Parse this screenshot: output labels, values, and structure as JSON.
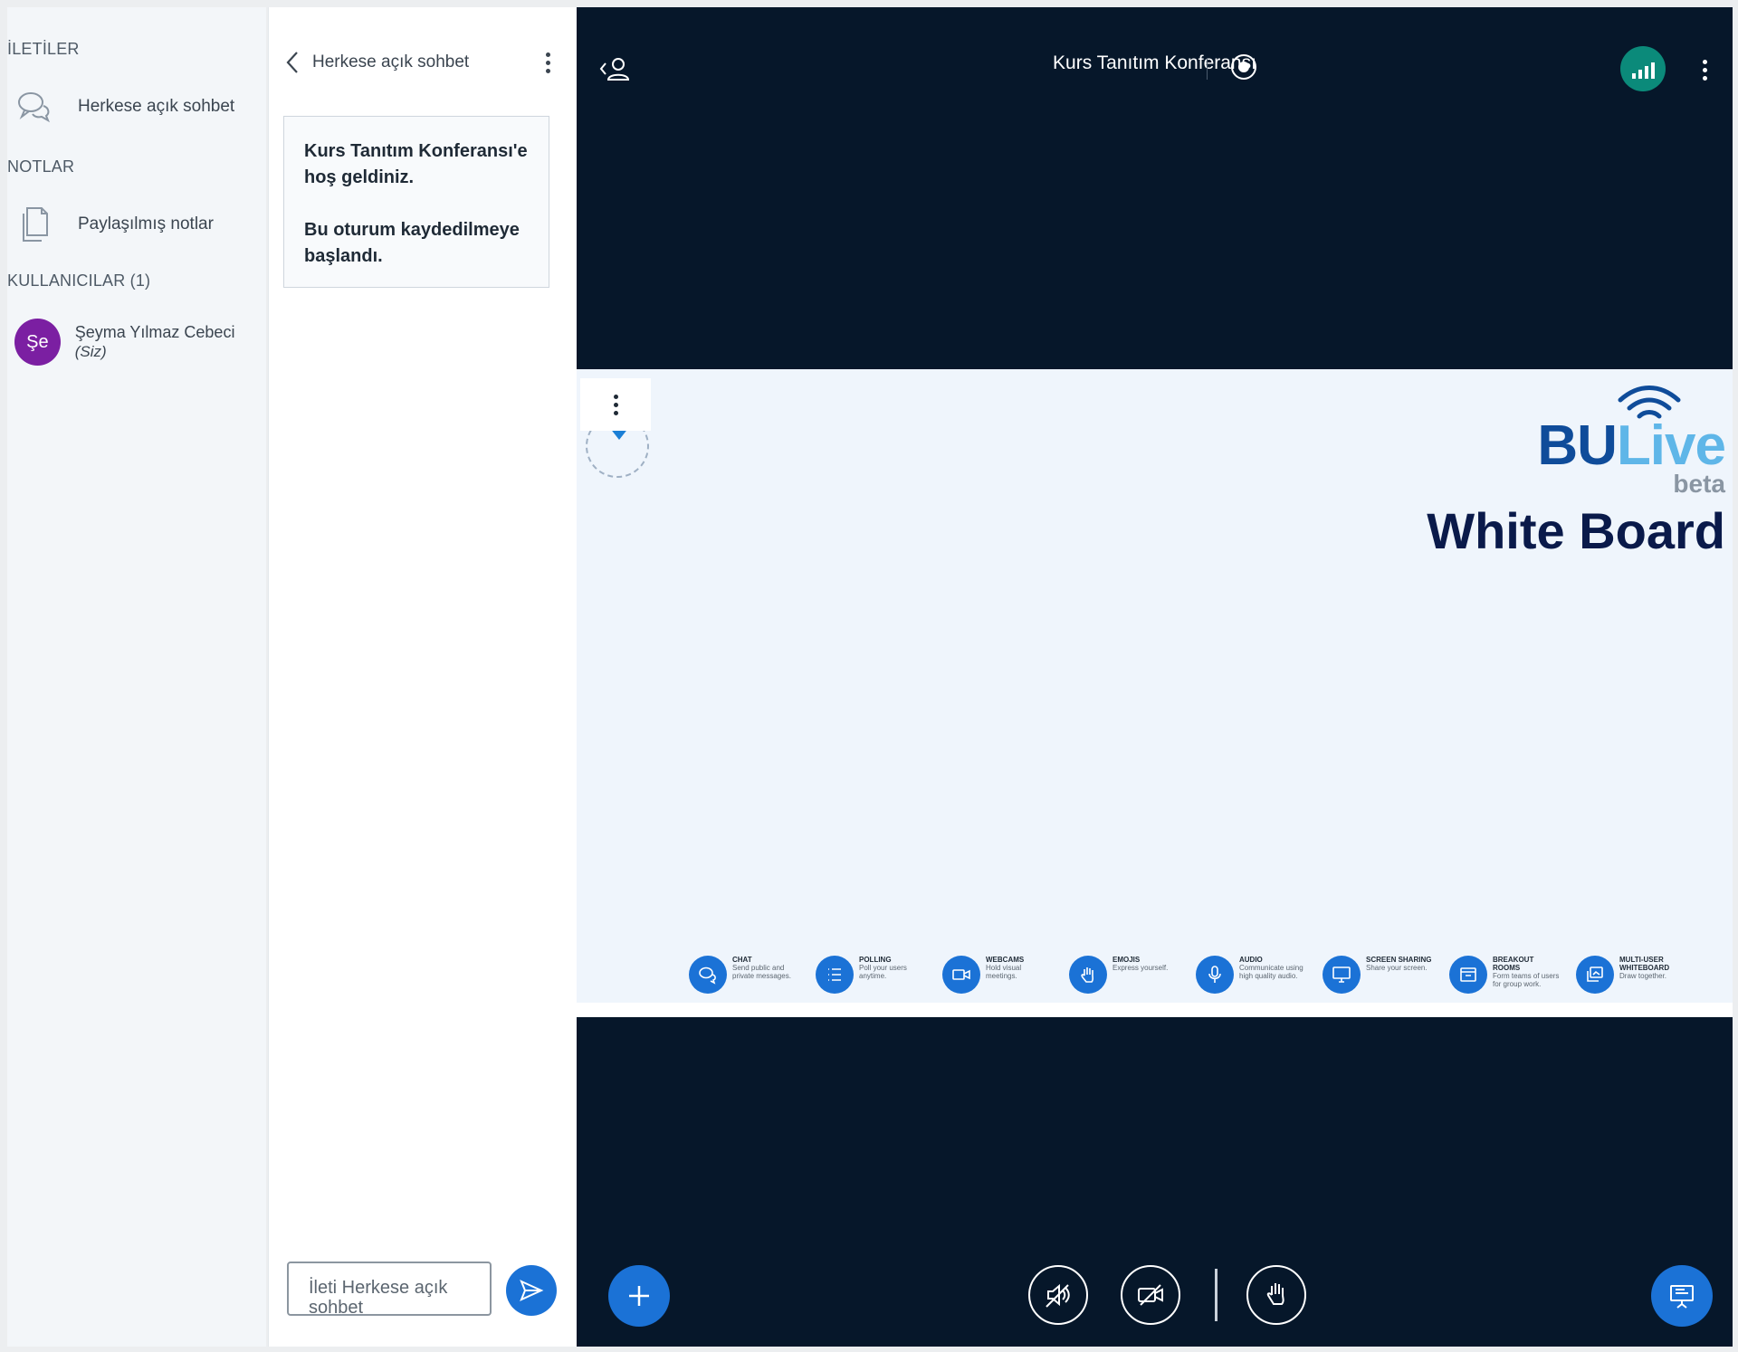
{
  "userlist": {
    "messages_title": "İLETİLER",
    "public_chat_label": "Herkese açık sohbet",
    "notes_title": "NOTLAR",
    "shared_notes_label": "Paylaşılmış notlar",
    "users_title": "KULLANICILAR (1)",
    "user": {
      "initials": "Şe",
      "name": "Şeyma Yılmaz Cebeci",
      "you_tag": "(Siz)",
      "avatar_color": "#7b1fa2"
    }
  },
  "chat": {
    "title": "Herkese açık sohbet",
    "welcome_line1": "Kurs Tanıtım Konferansı'e hoş geldiniz.",
    "welcome_line2": "Bu oturum kaydedilmeye başlandı.",
    "input_placeholder": "İleti Herkese açık sohbet"
  },
  "main": {
    "meeting_title": "Kurs Tanıtım Konferansı",
    "accent_color": "#1b72d6",
    "background_color": "#06172a"
  },
  "slide": {
    "brand_bu": "BU",
    "brand_live": "Live",
    "brand_beta": "beta",
    "heading": "White Board",
    "features": [
      {
        "title": "CHAT",
        "desc": "Send public and private messages.",
        "icon": "chat-icon"
      },
      {
        "title": "POLLING",
        "desc": "Poll your users anytime.",
        "icon": "list-icon"
      },
      {
        "title": "WEBCAMS",
        "desc": "Hold visual meetings.",
        "icon": "video-icon"
      },
      {
        "title": "EMOJIS",
        "desc": "Express yourself.",
        "icon": "hand-icon"
      },
      {
        "title": "AUDIO",
        "desc": "Communicate using high quality audio.",
        "icon": "mic-icon"
      },
      {
        "title": "SCREEN SHARING",
        "desc": "Share your screen.",
        "icon": "monitor-icon"
      },
      {
        "title": "BREAKOUT ROOMS",
        "desc": "Form teams of users for group work.",
        "icon": "rooms-icon"
      },
      {
        "title": "MULTI-USER WHITEBOARD",
        "desc": "Draw together.",
        "icon": "whiteboard-icon"
      }
    ]
  }
}
